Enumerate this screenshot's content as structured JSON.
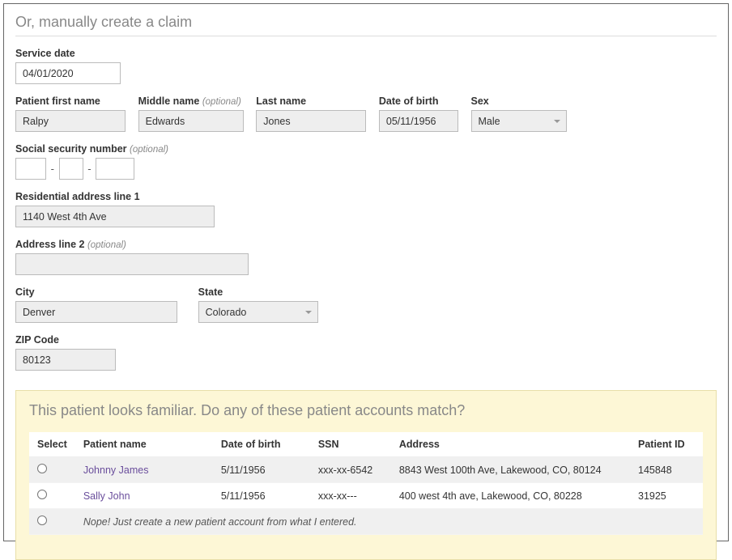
{
  "section_title": "Or, manually create a claim",
  "fields": {
    "service_date": {
      "label": "Service date",
      "value": "04/01/2020"
    },
    "first_name": {
      "label": "Patient first name",
      "value": "Ralpy"
    },
    "middle_name": {
      "label": "Middle name",
      "optional": "(optional)",
      "value": "Edwards"
    },
    "last_name": {
      "label": "Last name",
      "value": "Jones"
    },
    "dob": {
      "label": "Date of birth",
      "value": "05/11/1956"
    },
    "sex": {
      "label": "Sex",
      "value": "Male"
    },
    "ssn": {
      "label": "Social security number",
      "optional": "(optional)"
    },
    "addr1": {
      "label": "Residential address line 1",
      "value": "1140 West 4th Ave"
    },
    "addr2": {
      "label": "Address line 2",
      "optional": "(optional)",
      "value": ""
    },
    "city": {
      "label": "City",
      "value": "Denver"
    },
    "state": {
      "label": "State",
      "value": "Colorado"
    },
    "zip": {
      "label": "ZIP Code",
      "value": "80123"
    }
  },
  "match": {
    "prompt": "This patient looks familiar. Do any of these patient accounts match?",
    "headers": {
      "select": "Select",
      "name": "Patient name",
      "dob": "Date of birth",
      "ssn": "SSN",
      "address": "Address",
      "pid": "Patient ID"
    },
    "rows": [
      {
        "name": "Johnny James",
        "dob": "5/11/1956",
        "ssn": "xxx-xx-6542",
        "address": "8843 West 100th Ave, Lakewood, CO, 80124",
        "pid": "145848"
      },
      {
        "name": "Sally John",
        "dob": "5/11/1956",
        "ssn": "xxx-xx---",
        "address": "400 west 4th ave, Lakewood, CO, 80228",
        "pid": "31925"
      }
    ],
    "new_option": "Nope! Just create a new patient account from what I entered."
  }
}
